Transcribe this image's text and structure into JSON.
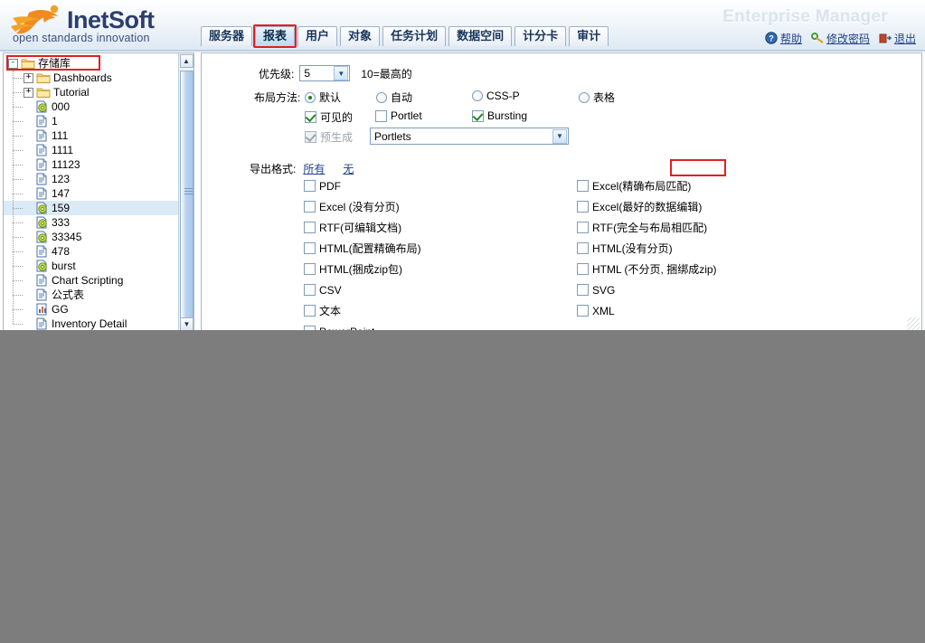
{
  "header": {
    "logo_text": "InetSoft",
    "logo_tagline": "open standards innovation",
    "app_title": "Enterprise Manager",
    "tabs": [
      {
        "label": "服务器",
        "selected": false
      },
      {
        "label": "报表",
        "selected": true
      },
      {
        "label": "用户",
        "selected": false
      },
      {
        "label": "对象",
        "selected": false
      },
      {
        "label": "任务计划",
        "selected": false
      },
      {
        "label": "数据空间",
        "selected": false
      },
      {
        "label": "计分卡",
        "selected": false
      },
      {
        "label": "审计",
        "selected": false
      }
    ],
    "links": [
      {
        "label": "帮助",
        "icon": "help-icon"
      },
      {
        "label": "修改密码",
        "icon": "key-icon"
      },
      {
        "label": "退出",
        "icon": "exit-icon"
      }
    ]
  },
  "tree": {
    "root": {
      "label": "存储库",
      "expander": "-",
      "icon": "folder-icon",
      "highlighted": true
    },
    "items": [
      {
        "label": "Dashboards",
        "expander": "+",
        "icon": "folder-icon",
        "selected": false
      },
      {
        "label": "Tutorial",
        "expander": "+",
        "icon": "folder-icon",
        "selected": false
      },
      {
        "label": "000",
        "expander": "",
        "icon": "dashboard-icon",
        "selected": false
      },
      {
        "label": "1",
        "expander": "",
        "icon": "report-icon",
        "selected": false
      },
      {
        "label": "111",
        "expander": "",
        "icon": "report-icon",
        "selected": false
      },
      {
        "label": "1111",
        "expander": "",
        "icon": "report-icon",
        "selected": false
      },
      {
        "label": "11123",
        "expander": "",
        "icon": "report-icon",
        "selected": false
      },
      {
        "label": "123",
        "expander": "",
        "icon": "report-icon",
        "selected": false
      },
      {
        "label": "147",
        "expander": "",
        "icon": "report-icon",
        "selected": false
      },
      {
        "label": "159",
        "expander": "",
        "icon": "dashboard-icon",
        "selected": true
      },
      {
        "label": "333",
        "expander": "",
        "icon": "dashboard-icon",
        "selected": false
      },
      {
        "label": "33345",
        "expander": "",
        "icon": "dashboard-icon",
        "selected": false
      },
      {
        "label": "478",
        "expander": "",
        "icon": "report-icon",
        "selected": false
      },
      {
        "label": "burst",
        "expander": "",
        "icon": "dashboard-icon",
        "selected": false
      },
      {
        "label": "Chart Scripting",
        "expander": "",
        "icon": "report-icon",
        "selected": false
      },
      {
        "label": "公式表",
        "expander": "",
        "icon": "report-icon",
        "selected": false
      },
      {
        "label": "GG",
        "expander": "",
        "icon": "chart-icon",
        "selected": false
      },
      {
        "label": "Inventory Detail",
        "expander": "",
        "icon": "report-icon",
        "selected": false
      }
    ]
  },
  "form": {
    "priority_label": "优先级:",
    "priority_value": "5",
    "priority_hint": "10=最高的",
    "layout_label": "布局方法:",
    "layout_options": [
      {
        "label": "默认",
        "checked": true
      },
      {
        "label": "自动",
        "checked": false
      },
      {
        "label": "CSS-P",
        "checked": false
      },
      {
        "label": "表格",
        "checked": false
      }
    ],
    "visible": {
      "label": "可见的",
      "checked": true,
      "disabled": false
    },
    "portlet": {
      "label": "Portlet",
      "checked": false,
      "disabled": false
    },
    "bursting": {
      "label": "Bursting",
      "checked": true,
      "disabled": false,
      "highlighted": true
    },
    "pregen": {
      "label": "预生成",
      "checked": true,
      "disabled": true
    },
    "portlet_select_value": "Portlets",
    "export_label": "导出格式:",
    "export_all": "所有",
    "export_none": "无",
    "export_left": [
      {
        "label": "PDF",
        "checked": false
      },
      {
        "label": "Excel (没有分页)",
        "checked": false
      },
      {
        "label": "RTF(可编辑文档)",
        "checked": false
      },
      {
        "label": "HTML(配置精确布局)",
        "checked": false
      },
      {
        "label": "HTML(捆成zip包)",
        "checked": false
      },
      {
        "label": "CSV",
        "checked": false
      },
      {
        "label": "文本",
        "checked": false
      },
      {
        "label": "PowerPoint",
        "checked": false
      }
    ],
    "export_right": [
      {
        "label": "Excel(精确布局匹配)",
        "checked": false
      },
      {
        "label": "Excel(最好的数据编辑)",
        "checked": false
      },
      {
        "label": "RTF(完全与布局相匹配)",
        "checked": false
      },
      {
        "label": "HTML(没有分页)",
        "checked": false
      },
      {
        "label": "HTML (不分页, 捆绑成zip)",
        "checked": false
      },
      {
        "label": "SVG",
        "checked": false
      },
      {
        "label": "XML",
        "checked": false
      }
    ]
  },
  "colors": {
    "accent_red": "#e02020",
    "link_blue": "#20418a",
    "logo_navy": "#2c3e70",
    "logo_orange": "#f08a1e",
    "selection_blue": "#dbeaf7"
  }
}
